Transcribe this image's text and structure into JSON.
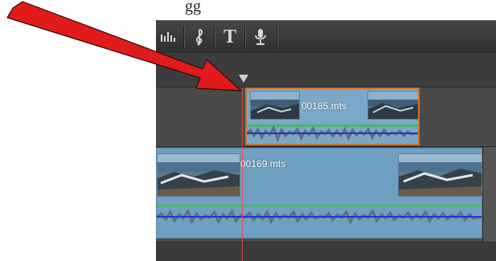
{
  "caption_fragment": "gg",
  "toolbar": {
    "icons": [
      "audio-levels-icon",
      "music-note-icon",
      "title-text-icon",
      "voiceover-mic-icon"
    ],
    "text_tool_glyph": "T"
  },
  "timeline": {
    "clips": [
      {
        "name": "00185.mts",
        "track": 1,
        "selected": true
      },
      {
        "name": "00169.mts",
        "track": 2,
        "selected": false
      }
    ]
  },
  "colors": {
    "arrow": "#e11b1b",
    "selected_clip_border": "#c9742e",
    "playhead": "#e04848",
    "audio_line": "#2a2fd0",
    "audio_wave_top": "#48b86a"
  }
}
